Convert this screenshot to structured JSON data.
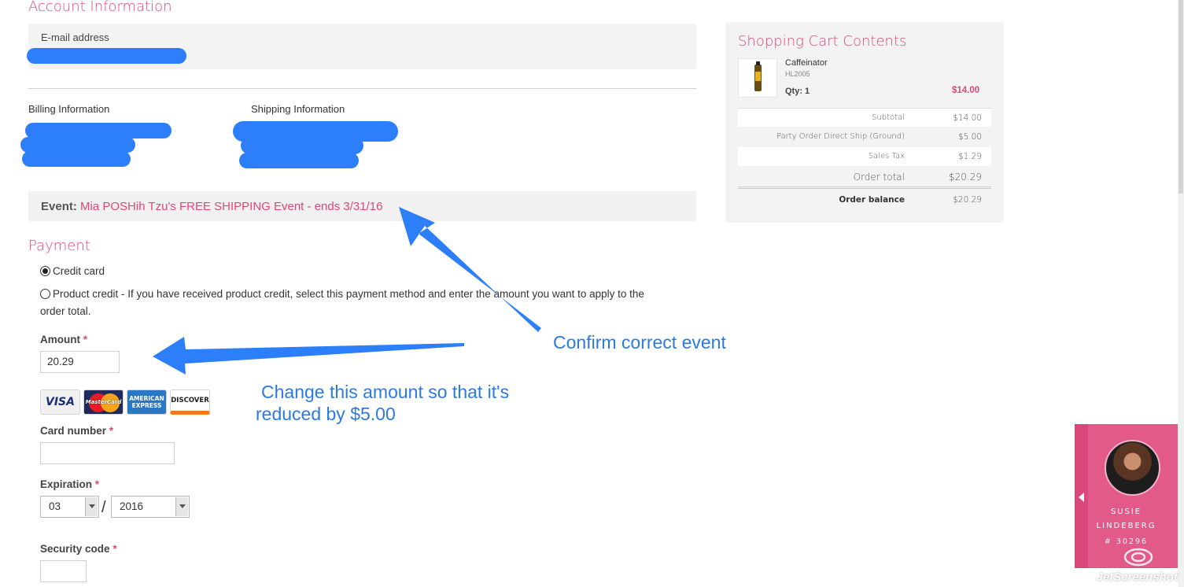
{
  "account": {
    "title": "Account Information",
    "email_label": "E-mail address"
  },
  "billing": {
    "label": "Billing Information"
  },
  "shipping": {
    "label": "Shipping Information"
  },
  "event": {
    "label": "Event:",
    "value": "Mia POSHih Tzu's FREE SHIPPING Event - ends 3/31/16"
  },
  "payment": {
    "title": "Payment",
    "options": [
      {
        "label": "Credit card",
        "checked": true
      },
      {
        "label": "Product credit - If you have received product credit, select this payment method and enter the amount you want to apply to the",
        "label_line2": "order total.",
        "checked": false
      }
    ],
    "amount_label": "Amount",
    "amount_value": "20.29",
    "cards": [
      "VISA",
      "MasterCard",
      "AMERICAN EXPRESS",
      "DISCOVER"
    ],
    "card_number_label": "Card number",
    "expiration_label": "Expiration",
    "exp_month": "03",
    "exp_sep": "/",
    "exp_year": "2016",
    "security_label": "Security code",
    "required_mark": "*"
  },
  "cart": {
    "title": "Shopping Cart Contents",
    "item": {
      "name": "Caffeinator",
      "sku": "HL2005",
      "qty": "Qty: 1",
      "price": "$14.00"
    },
    "summary": [
      {
        "label": "Subtotal",
        "value": "$14.00"
      },
      {
        "label": "Party Order Direct Ship (Ground)",
        "value": "$5.00"
      },
      {
        "label": "Sales Tax",
        "value": "$1.29"
      },
      {
        "label": "Order total",
        "value": "$20.29"
      },
      {
        "label": "Order balance",
        "value": "$20.29"
      }
    ]
  },
  "annotations": {
    "confirm_event": "Confirm correct event",
    "change_amount_line1": "Change this amount so that it's",
    "change_amount_line2": "reduced by $5.00"
  },
  "consultant": {
    "first_name": "SUSIE",
    "last_name": "LINDEBERG",
    "id": "# 30296"
  },
  "watermark": "JetScreenshot",
  "colors": {
    "accent": "#e0467b",
    "annotation": "#2a7ae2",
    "panel": "#f3f3f3"
  }
}
